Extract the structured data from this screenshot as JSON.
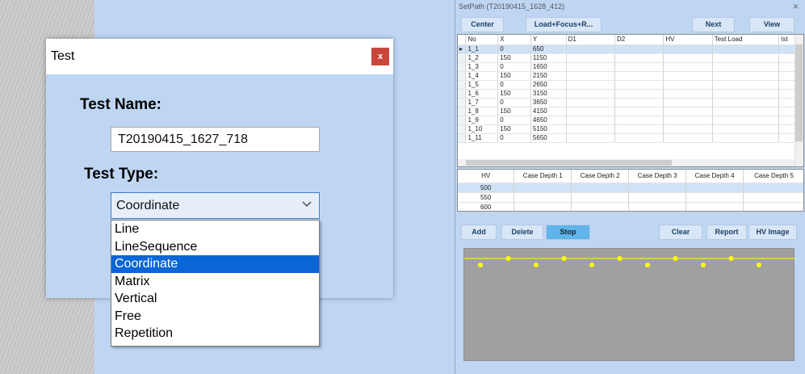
{
  "test_dialog": {
    "title": "Test",
    "close_label": "x",
    "name_label": "Test Name:",
    "name_value": "T20190415_1627_718",
    "type_label": "Test Type:",
    "type_value": "Coordinate",
    "type_options": [
      "Line",
      "LineSequence",
      "Coordinate",
      "Matrix",
      "Vertical",
      "Free",
      "Repetition"
    ],
    "selected_option": "Coordinate"
  },
  "setpath": {
    "title": "SetPath (T20190415_1628_412)",
    "close_label": "×",
    "buttons_top": {
      "center": "Center",
      "load_focus": "Load+Focus+R...",
      "next": "Next",
      "view": "View"
    },
    "grid_columns": [
      "No",
      "X",
      "Y",
      "D1",
      "D2",
      "HV",
      "Test Load",
      "Ist"
    ],
    "grid_rows": [
      {
        "no": "1_1",
        "x": "0",
        "y": "650"
      },
      {
        "no": "1_2",
        "x": "150",
        "y": "1150"
      },
      {
        "no": "1_3",
        "x": "0",
        "y": "1650"
      },
      {
        "no": "1_4",
        "x": "150",
        "y": "2150"
      },
      {
        "no": "1_5",
        "x": "0",
        "y": "2650"
      },
      {
        "no": "1_6",
        "x": "150",
        "y": "3150"
      },
      {
        "no": "1_7",
        "x": "0",
        "y": "3650"
      },
      {
        "no": "1_8",
        "x": "150",
        "y": "4150"
      },
      {
        "no": "1_9",
        "x": "0",
        "y": "4650"
      },
      {
        "no": "1_10",
        "x": "150",
        "y": "5150"
      },
      {
        "no": "1_11",
        "x": "0",
        "y": "5650"
      }
    ],
    "hv_columns": [
      "HV",
      "Case Depth 1",
      "Case Depth 2",
      "Case Depth 3",
      "Case Depth 4",
      "Case Depth 5"
    ],
    "hv_values": [
      "500",
      "550",
      "600"
    ],
    "buttons_bottom": {
      "add": "Add",
      "delete": "Delete",
      "stop": "Stop",
      "clear": "Clear",
      "report": "Report",
      "hv_image": "HV Image"
    },
    "colors": {
      "line": "#ffff00",
      "chart_bg": "#a0a0a0",
      "selection": "#0a66d6"
    }
  }
}
